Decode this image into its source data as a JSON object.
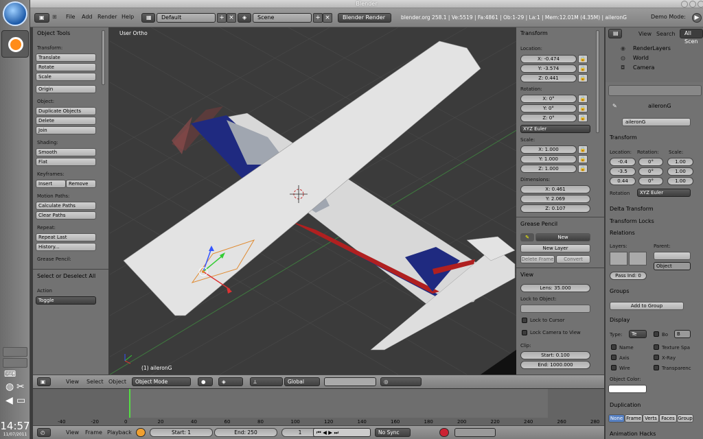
{
  "os": {
    "window_title": "Blender",
    "clock": "14:57",
    "date": "11/07/2011"
  },
  "header": {
    "menus": [
      "File",
      "Add",
      "Render",
      "Help"
    ],
    "screen_layout": "Default",
    "scene": "Scene",
    "render_engine": "Blender Render",
    "stats": "blender.org 258.1 | Ve:5519 | Fa:4861 | Ob:1-29 | La:1 | Mem:12.01M (4.35M) | aileronG",
    "demo_mode": "Demo Mode:"
  },
  "tool_shelf": {
    "title": "Object Tools",
    "transform_label": "Transform:",
    "translate": "Translate",
    "rotate": "Rotate",
    "scale": "Scale",
    "origin": "Origin",
    "object_label": "Object:",
    "duplicate": "Duplicate Objects",
    "delete": "Delete",
    "join": "Join",
    "shading_label": "Shading:",
    "smooth": "Smooth",
    "flat": "Flat",
    "keyframes_label": "Keyframes:",
    "insert": "Insert",
    "remove": "Remove",
    "motion_paths_label": "Motion Paths:",
    "calc_paths": "Calculate Paths",
    "clear_paths": "Clear Paths",
    "repeat_label": "Repeat:",
    "repeat_last": "Repeat Last",
    "history": "History...",
    "grease_pencil_label": "Grease Pencil:",
    "operator_title": "Select or Deselect All",
    "action_label": "Action",
    "action_value": "Toggle"
  },
  "viewport": {
    "view_label": "User Ortho",
    "object_label": "(1) aileronG"
  },
  "properties_panel": {
    "transform_title": "Transform",
    "location_label": "Location:",
    "loc_x": "X: -0.474",
    "loc_y": "Y: -3.574",
    "loc_z": "Z: 0.441",
    "rotation_label": "Rotation:",
    "rot_x": "X: 0°",
    "rot_y": "Y: 0°",
    "rot_z": "Z: 0°",
    "rotation_mode": "XYZ Euler",
    "scale_label": "Scale:",
    "scale_x": "X: 1.000",
    "scale_y": "Y: 1.000",
    "scale_z": "Z: 1.000",
    "dimensions_label": "Dimensions:",
    "dim_x": "X: 0.461",
    "dim_y": "Y: 2.069",
    "dim_z": "Z: 0.107",
    "grease_title": "Grease Pencil",
    "gp_new": "New",
    "gp_new_layer": "New Layer",
    "gp_delete_frame": "Delete Frame",
    "gp_convert": "Convert",
    "view_title": "View",
    "lens": "Lens: 35.000",
    "lock_to_object": "Lock to Object:",
    "lock_to_cursor": "Lock to Cursor",
    "lock_camera": "Lock Camera to View",
    "clip_label": "Clip:",
    "clip_start": "Start: 0.100",
    "clip_end": "End: 1000.000"
  },
  "outliner": {
    "view": "View",
    "search": "Search",
    "all_scenes": "All Scen",
    "items": [
      "RenderLayers",
      "World",
      "Camera"
    ]
  },
  "prop_editor": {
    "breadcrumb": "aileronG",
    "object_name": "aileronG",
    "transform_title": "Transform",
    "location_label": "Location:",
    "rotation_label": "Rotation:",
    "scale_label": "Scale:",
    "loc_col": [
      "-0.4",
      "-3.5",
      "0.44"
    ],
    "rot_col": [
      "0°",
      "0°",
      "0°"
    ],
    "scale_col": [
      "1.00",
      "1.00",
      "1.00"
    ],
    "rotation_label2": "Rotation",
    "rotation_mode": "XYZ Euler",
    "delta_transform": "Delta Transform",
    "transform_locks": "Transform Locks",
    "relations": "Relations",
    "layers_label": "Layers:",
    "parent_label": "Parent:",
    "parent_type": "Object",
    "pass_index": "Pass Ind: 0",
    "groups": "Groups",
    "add_to_group": "Add to Group",
    "display": "Display",
    "type_label": "Type:",
    "type_value": "Te",
    "bounds_label": "Bo",
    "bounds_value": "B",
    "name": "Name",
    "texture_space": "Texture Spa",
    "axis": "Axis",
    "xray": "X-Ray",
    "wire": "Wire",
    "transparency": "Transparenc",
    "object_color": "Object Color:",
    "duplication": "Duplication",
    "dup_none": "None",
    "dup_frames": "Frame",
    "dup_verts": "Verts",
    "dup_faces": "Faces",
    "dup_group": "Group",
    "animation_hacks": "Animation Hacks"
  },
  "viewport_header": {
    "view": "View",
    "select": "Select",
    "object": "Object",
    "mode": "Object Mode",
    "orientation": "Global"
  },
  "timeline": {
    "ticks": [
      "-40",
      "-20",
      "0",
      "20",
      "40",
      "60",
      "80",
      "100",
      "120",
      "140",
      "160",
      "180",
      "200",
      "220",
      "240",
      "260",
      "280"
    ],
    "view": "View",
    "frame": "Frame",
    "playback": "Playback",
    "start": "Start: 1",
    "end": "End: 250",
    "current": "1",
    "sync": "No Sync"
  }
}
